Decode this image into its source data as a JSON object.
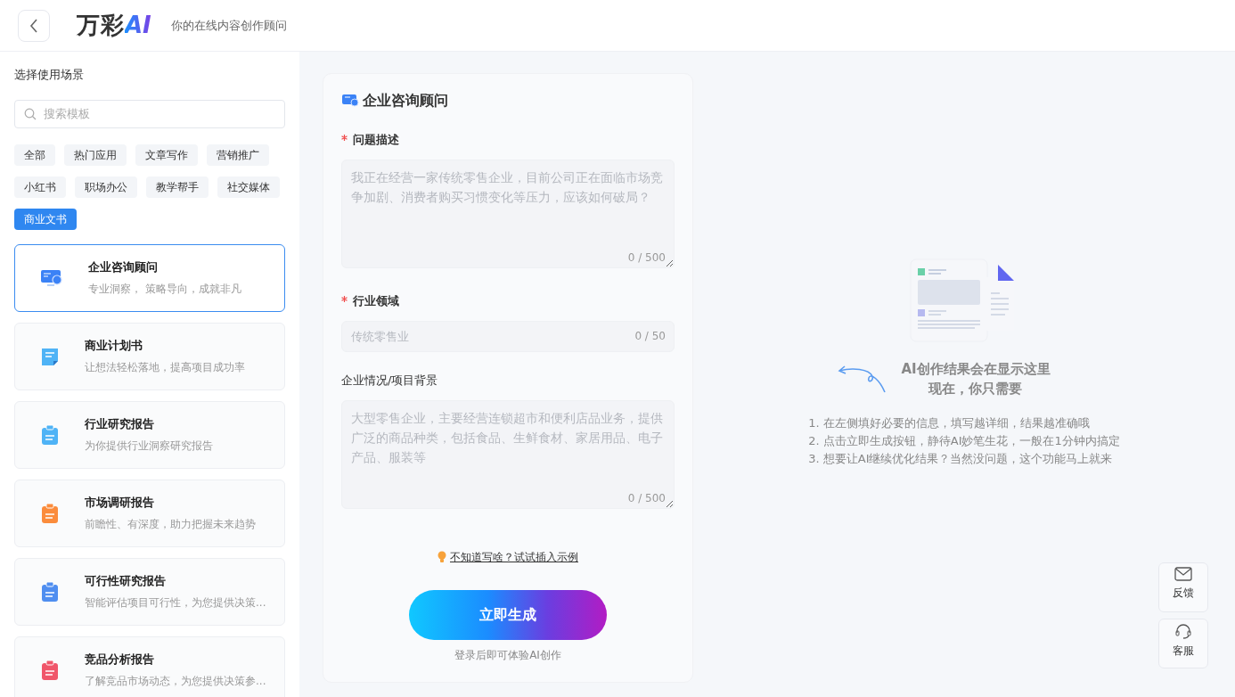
{
  "header": {
    "logo": {
      "text": "万彩",
      "mark": "AI"
    },
    "tagline": "你的在线内容创作顾问"
  },
  "sidebar": {
    "title": "选择使用场景",
    "search": {
      "placeholder": "搜索模板"
    },
    "filters": [
      {
        "label": "全部",
        "selected": false
      },
      {
        "label": "热门应用",
        "selected": false
      },
      {
        "label": "文章写作",
        "selected": false
      },
      {
        "label": "营销推广",
        "selected": false
      },
      {
        "label": "小红书",
        "selected": false
      },
      {
        "label": "职场办公",
        "selected": false
      },
      {
        "label": "教学帮手",
        "selected": false
      },
      {
        "label": "社交媒体",
        "selected": false
      },
      {
        "label": "商业文书",
        "selected": true
      }
    ],
    "templates": [
      {
        "title": "企业咨询顾问",
        "desc": "专业洞察， 策略导向，成就非凡",
        "selected": true,
        "kind": "monitor",
        "color": "#3b82f6"
      },
      {
        "title": "商业计划书",
        "desc": "让想法轻松落地，提高项目成功率",
        "selected": false,
        "kind": "note",
        "color": "#4fb3f6"
      },
      {
        "title": "行业研究报告",
        "desc": "为你提供行业洞察研究报告",
        "selected": false,
        "kind": "clipboard",
        "color": "#4fb3f6"
      },
      {
        "title": "市场调研报告",
        "desc": "前瞻性、有深度，助力把握未来趋势",
        "selected": false,
        "kind": "clipboard",
        "color": "#fb8c3c"
      },
      {
        "title": "可行性研究报告",
        "desc": "智能评估项目可行性，为您提供决策...",
        "selected": false,
        "kind": "clipboard",
        "color": "#4f8ef0"
      },
      {
        "title": "竞品分析报告",
        "desc": "了解竞品市场动态，为您提供决策参...",
        "selected": false,
        "kind": "clipboard",
        "color": "#f0566a"
      }
    ]
  },
  "form": {
    "title": "企业咨询顾问",
    "fields": [
      {
        "label": "问题描述",
        "required": true,
        "kind": "textarea",
        "placeholder": "我正在经营一家传统零售企业，目前公司正在面临市场竞争加剧、消费者购买习惯变化等压力，应该如何破局？",
        "counter": "0 / 500"
      },
      {
        "label": "行业领域",
        "required": true,
        "kind": "input",
        "placeholder": "传统零售业",
        "counter": "0 / 50"
      },
      {
        "label": "企业情况/项目背景",
        "required": false,
        "kind": "textarea",
        "placeholder": "大型零售企业，主要经营连锁超市和便利店品业务，提供广泛的商品种类，包括食品、生鲜食材、家居用品、电子产品、服装等",
        "counter": "0 / 500"
      }
    ],
    "example_link": "不知道写啥？试试插入示例",
    "submit": "立即生成",
    "login_note": "登录后即可体验AI创作"
  },
  "result": {
    "heading": [
      "AI创作结果会在显示这里",
      "现在，你只需要"
    ],
    "steps": [
      "1. 在左侧填好必要的信息，填写越详细，结果越准确哦",
      "2. 点击立即生成按钮，静待AI妙笔生花，一般在1分钟内搞定",
      "3. 想要让AI继续优化结果？当然没问题，这个功能马上就来"
    ]
  },
  "float_buttons": [
    {
      "label": "反馈",
      "kind": "mail"
    },
    {
      "label": "客服",
      "kind": "headset"
    }
  ]
}
